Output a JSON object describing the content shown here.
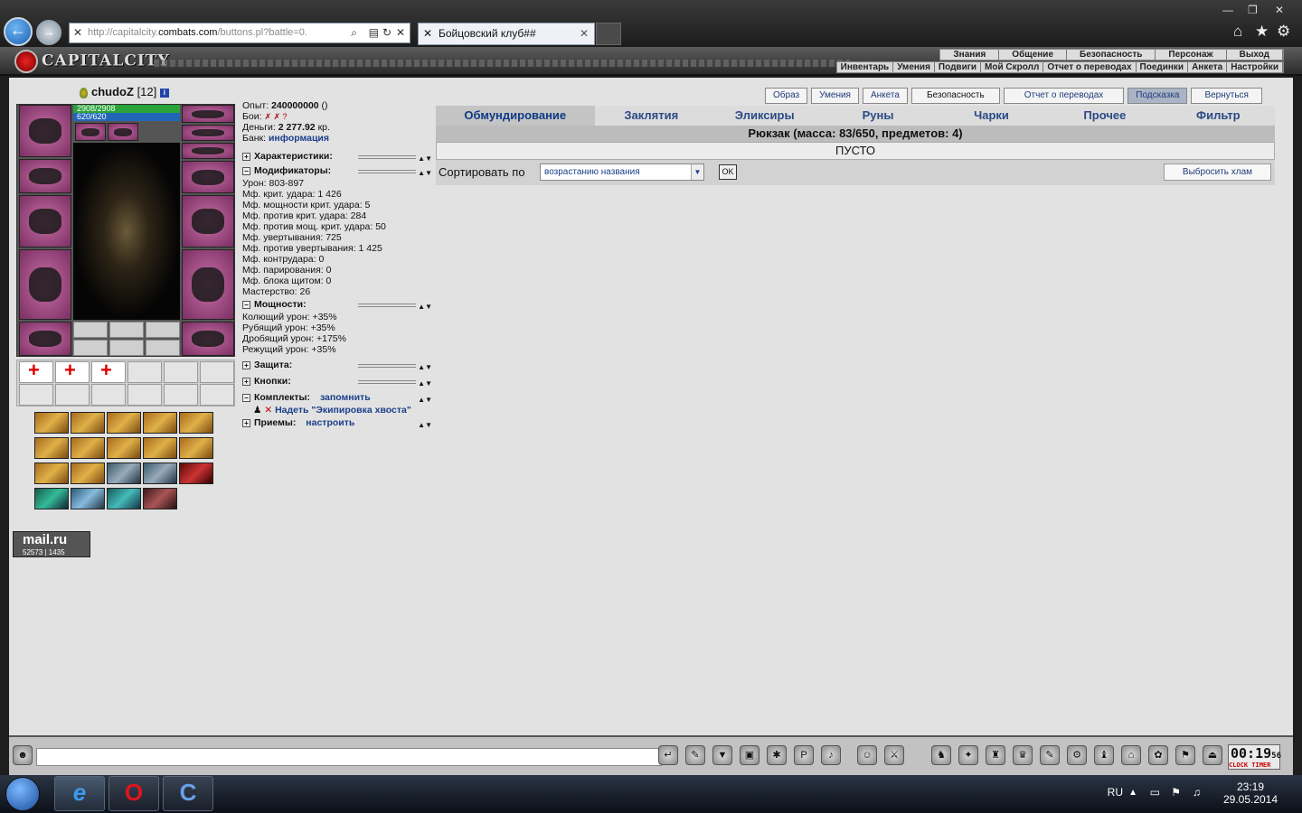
{
  "browser": {
    "url_prefix": "http://capitalcity.",
    "url_domain": "combats.com",
    "url_rest": "/buttons.pl?battle=0.",
    "tab_title": "Бойцовский клуб##"
  },
  "game": {
    "logo": "CAPITALCITY",
    "main_menu": [
      "Знания",
      "Общение",
      "Безопасность",
      "Персонаж",
      "Выход"
    ],
    "sub_menu": [
      "Инвентарь",
      "Умения",
      "Подвиги",
      "Мой Скролл",
      "Отчет о переводах",
      "Поединки",
      "Анкета",
      "Настройки"
    ]
  },
  "player": {
    "name": "chudoZ",
    "level": "[12]",
    "hp": "2908/2908",
    "mana": "620/620"
  },
  "stats": {
    "exp_label": "Опыт:",
    "exp_value": "240000000",
    "exp_extra": "()",
    "fights_label": "Бои:",
    "money_label": "Деньги:",
    "money_value": "2 277.92",
    "money_unit": "кр.",
    "bank_label": "Банк:",
    "bank_link": "информация",
    "sections": {
      "characteristics": "Характеристики:",
      "modifiers": "Модификаторы:",
      "powers": "Мощности:",
      "protection": "Защита:",
      "buttons": "Кнопки:",
      "sets": "Комплекты:",
      "sets_link": "запомнить",
      "set_item": "Надеть \"Экипировка хвоста\"",
      "tricks": "Приемы:",
      "tricks_link": "настроить"
    },
    "modifiers": [
      "Урон: 803-897",
      "Мф. крит. удара: 1 426",
      "Мф. мощности крит. удара: 5",
      "Мф. против крит. удара: 284",
      "Мф. против мощ. крит. удара: 50",
      "Мф. увертывания: 725",
      "Мф. против увертывания: 1 425",
      "Мф. контрудара: 0",
      "Мф. парирования: 0",
      "Мф. блока щитом: 0",
      "Мастерство: 26"
    ],
    "powers": [
      "Колющий урон: +35%",
      "Рубящий урон: +35%",
      "Дробящий урон: +175%",
      "Режущий урон: +35%"
    ]
  },
  "top_buttons": [
    "Образ",
    "Умения",
    "Анкета",
    "Безопасность",
    "Отчет о переводах",
    "Подсказка",
    "Вернуться"
  ],
  "inventory": {
    "tabs": [
      "Обмундирование",
      "Заклятия",
      "Эликсиры",
      "Руны",
      "Чарки",
      "Прочее",
      "Фильтр"
    ],
    "bag_title": "Рюкзак (масса: 83/650, предметов: 4)",
    "empty": "ПУСТО",
    "sort_label": "Сортировать по",
    "sort_value": "возрастанию названия",
    "ok": "OK",
    "junk_button": "Выбросить хлам"
  },
  "counter": {
    "brand": "mail.ru",
    "hits": "52573",
    "hosts": "1435"
  },
  "chat": {
    "clock": "00:19",
    "clock_sec": "56",
    "clock_labels": "CLOCK  TIMER"
  },
  "taskbar": {
    "lang": "RU",
    "time": "23:19",
    "date": "29.05.2014"
  },
  "colors": {
    "hp": "#2aa43a",
    "mana": "#2266b8",
    "link": "#1a3f8a"
  }
}
